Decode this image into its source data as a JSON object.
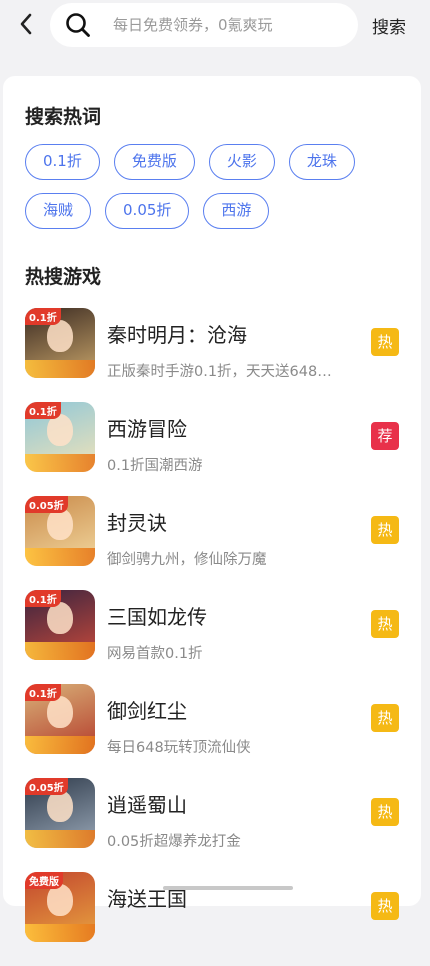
{
  "header": {
    "search_placeholder": "每日免费领券，0氪爽玩",
    "search_button": "搜索"
  },
  "hot_words": {
    "title": "搜索热词",
    "tags": [
      "0.1折",
      "免费版",
      "火影",
      "龙珠",
      "海贼",
      "0.05折",
      "西游"
    ]
  },
  "hot_games": {
    "title": "热搜游戏",
    "items": [
      {
        "name": "秦时明月：沧海",
        "desc": "正版秦时手游0.1折，天天送648…",
        "badge": "热",
        "badge_type": "hot",
        "icon_label": "0.1折",
        "colors": [
          "#3a2a22",
          "#c9a56a"
        ]
      },
      {
        "name": "西游冒险",
        "desc": "0.1折国潮西游",
        "badge": "荐",
        "badge_type": "rec",
        "icon_label": "0.1折",
        "colors": [
          "#8fc7d8",
          "#f1e3b8"
        ]
      },
      {
        "name": "封灵诀",
        "desc": "御剑骋九州，修仙除万魔",
        "badge": "热",
        "badge_type": "hot",
        "icon_label": "0.05折",
        "colors": [
          "#c98a4a",
          "#f3d9a0"
        ]
      },
      {
        "name": "三国如龙传",
        "desc": "网易首款0.1折",
        "badge": "热",
        "badge_type": "hot",
        "icon_label": "0.1折",
        "colors": [
          "#3a2440",
          "#c84a3a"
        ]
      },
      {
        "name": "御剑红尘",
        "desc": "每日648玩转顶流仙侠",
        "badge": "热",
        "badge_type": "hot",
        "icon_label": "0.1折",
        "colors": [
          "#d9b37a",
          "#b43a2a"
        ]
      },
      {
        "name": "逍遥蜀山",
        "desc": "0.05折超爆养龙打金",
        "badge": "热",
        "badge_type": "hot",
        "icon_label": "0.05折",
        "colors": [
          "#2e3a4a",
          "#9aa8b8"
        ]
      },
      {
        "name": "海送王国",
        "desc": "",
        "badge": "热",
        "badge_type": "hot",
        "icon_label": "免费版",
        "colors": [
          "#c2462e",
          "#e9a440"
        ]
      }
    ]
  }
}
